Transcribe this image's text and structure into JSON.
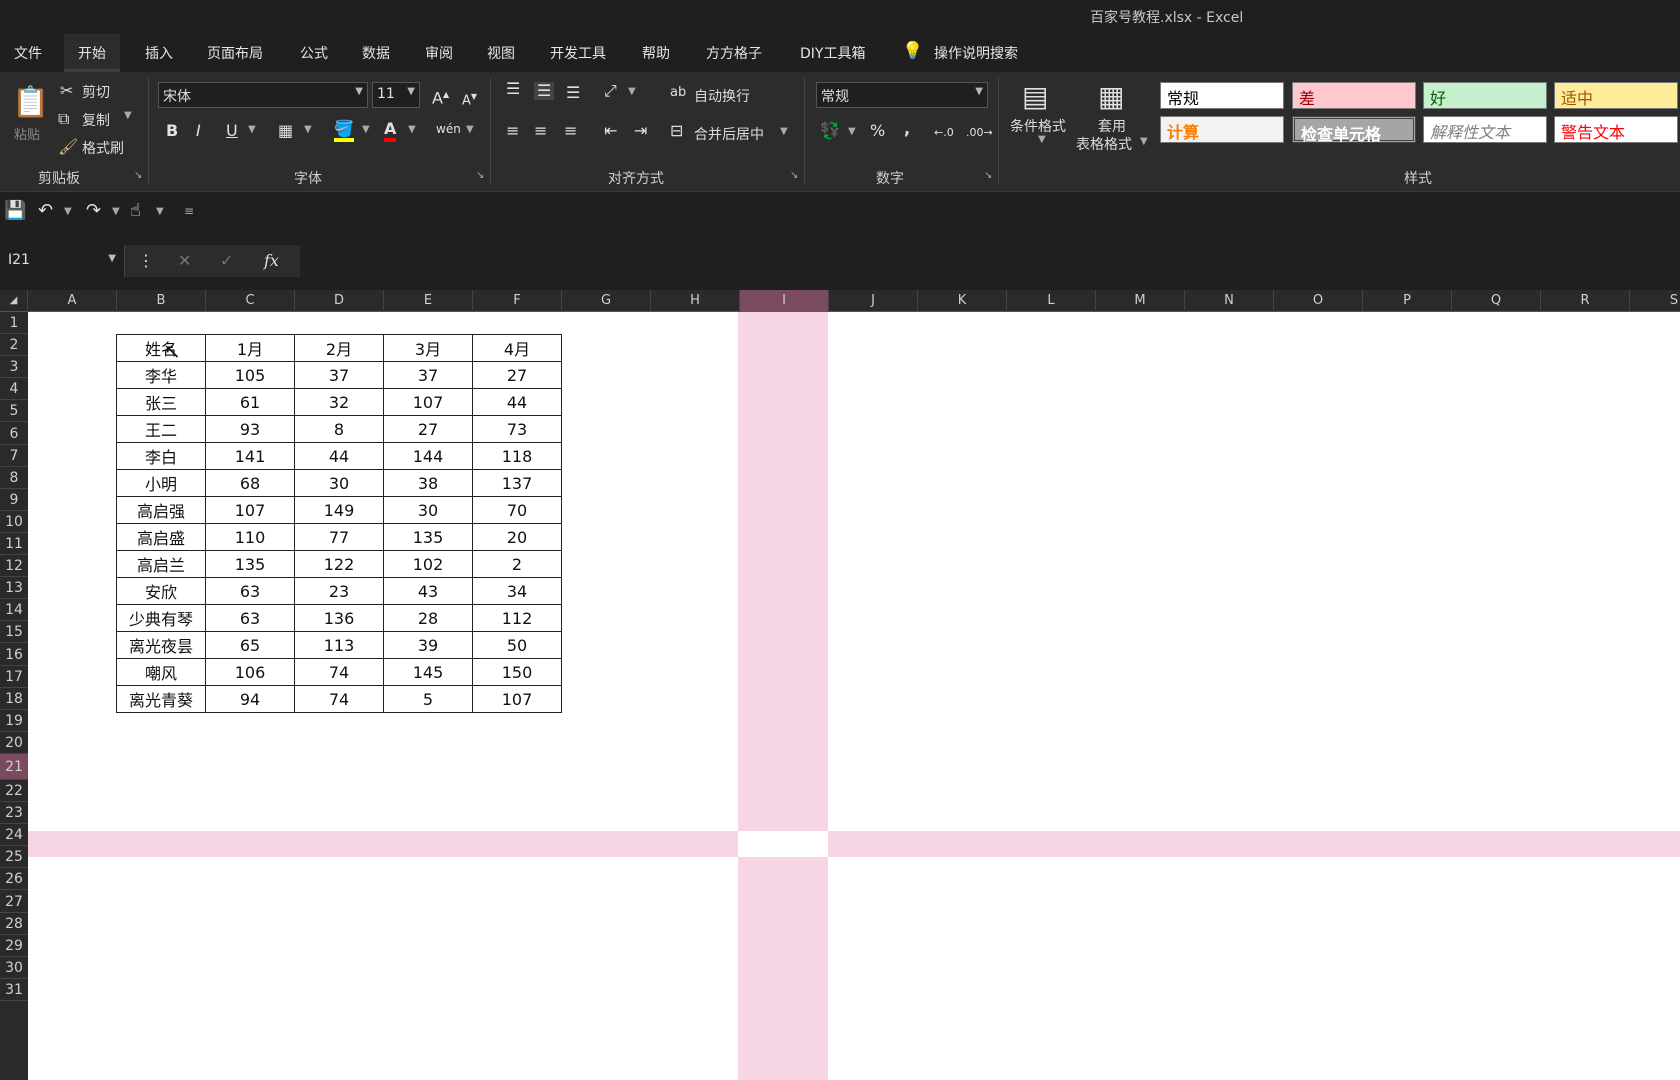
{
  "titlebar": {
    "title": "百家号教程.xlsx  -  Excel"
  },
  "menu": [
    "文件",
    "开始",
    "插入",
    "页面布局",
    "公式",
    "数据",
    "审阅",
    "视图",
    "开发工具",
    "帮助",
    "方方格子",
    "DIY工具箱",
    "操作说明搜索"
  ],
  "ribbon": {
    "clipboard": {
      "paste": "粘贴",
      "cut": "剪切",
      "copy": "复制",
      "format_painter": "格式刷",
      "label": "剪贴板"
    },
    "font": {
      "family": "宋体",
      "size": "11",
      "label": "字体",
      "bold": "B",
      "italic": "I",
      "underline": "U"
    },
    "alignment": {
      "wrap": "自动换行",
      "merge": "合并后居中",
      "label": "对齐方式"
    },
    "number": {
      "format": "常规",
      "percent": "%",
      "comma": ",",
      "label": "数字"
    },
    "styles": {
      "conditional": "条件格式",
      "table_format_1": "套用",
      "table_format_2": "表格格式",
      "label": "样式",
      "cells": [
        {
          "text": "常规",
          "bg": "#ffffff",
          "fg": "#000000"
        },
        {
          "text": "差",
          "bg": "#ffc7ce",
          "fg": "#9c0006"
        },
        {
          "text": "好",
          "bg": "#c6efce",
          "fg": "#006100"
        },
        {
          "text": "适中",
          "bg": "#ffeb9c",
          "fg": "#9c5700"
        },
        {
          "text": "计算",
          "bg": "#f2f2f2",
          "fg": "#fa7d00"
        },
        {
          "text": "检查单元格",
          "bg": "#a5a5a5",
          "fg": "#ffffff"
        },
        {
          "text": "解释性文本",
          "bg": "#ffffff",
          "fg": "#7f7f7f"
        },
        {
          "text": "警告文本",
          "bg": "#ffffff",
          "fg": "#ff0000"
        }
      ]
    }
  },
  "formula_bar": {
    "name_box": "I21",
    "fx": "fx",
    "cancel": "✕",
    "enter": "✓",
    "more": "⋮"
  },
  "columns": [
    "A",
    "B",
    "C",
    "D",
    "E",
    "F",
    "G",
    "H",
    "I",
    "J",
    "K",
    "L",
    "M",
    "N",
    "O",
    "P",
    "Q",
    "R",
    "S"
  ],
  "rows": [
    "1",
    "2",
    "3",
    "4",
    "5",
    "6",
    "7",
    "8",
    "9",
    "10",
    "11",
    "12",
    "13",
    "14",
    "15",
    "16",
    "17",
    "18",
    "19",
    "20",
    "21",
    "22",
    "23",
    "24",
    "25",
    "26",
    "27",
    "28",
    "29",
    "30",
    "31"
  ],
  "table": {
    "header": [
      "姓名",
      "1月",
      "2月",
      "3月",
      "4月"
    ],
    "rows": [
      [
        "李华",
        "105",
        "37",
        "37",
        "27"
      ],
      [
        "张三",
        "61",
        "32",
        "107",
        "44"
      ],
      [
        "王二",
        "93",
        "8",
        "27",
        "73"
      ],
      [
        "李白",
        "141",
        "44",
        "144",
        "118"
      ],
      [
        "小明",
        "68",
        "30",
        "38",
        "137"
      ],
      [
        "高启强",
        "107",
        "149",
        "30",
        "70"
      ],
      [
        "高启盛",
        "110",
        "77",
        "135",
        "20"
      ],
      [
        "高启兰",
        "135",
        "122",
        "102",
        "2"
      ],
      [
        "安欣",
        "63",
        "23",
        "43",
        "34"
      ],
      [
        "少典有琴",
        "63",
        "136",
        "28",
        "112"
      ],
      [
        "离光夜昙",
        "65",
        "113",
        "39",
        "50"
      ],
      [
        "嘲风",
        "106",
        "74",
        "145",
        "150"
      ],
      [
        "离光青葵",
        "94",
        "74",
        "5",
        "107"
      ]
    ]
  }
}
